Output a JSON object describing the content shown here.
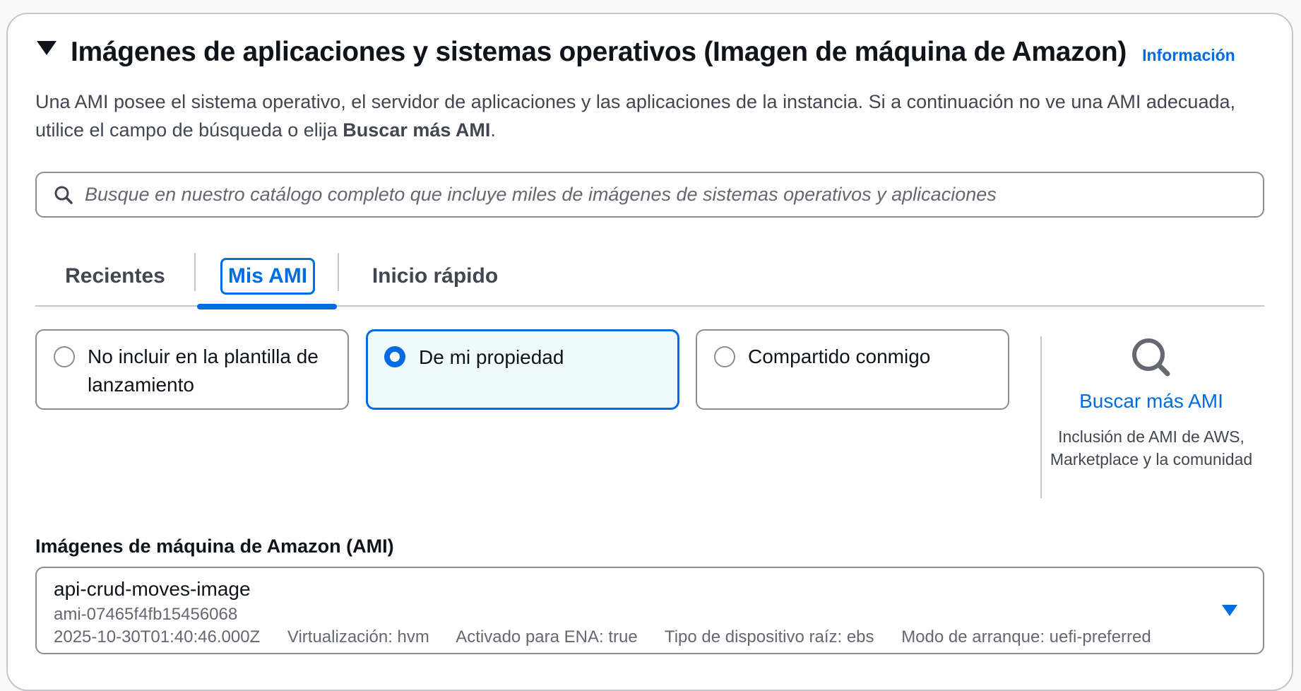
{
  "section": {
    "title": "Imágenes de aplicaciones y sistemas operativos (Imagen de máquina de Amazon)",
    "info_link": "Información",
    "description_prefix": "Una AMI posee el sistema operativo, el servidor de aplicaciones y las aplicaciones de la instancia. Si a continuación no ve una AMI adecuada, utilice el campo de búsqueda o elija ",
    "description_bold": "Buscar más AMI",
    "description_suffix": "."
  },
  "search": {
    "placeholder": "Busque en nuestro catálogo completo que incluye miles de imágenes de sistemas operativos y aplicaciones",
    "value": ""
  },
  "tabs": [
    {
      "label": "Recientes",
      "active": false
    },
    {
      "label": "Mis AMI",
      "active": true
    },
    {
      "label": "Inicio rápido",
      "active": false
    }
  ],
  "ownership_options": [
    {
      "label": "No incluir en la plantilla de lanzamiento",
      "selected": false
    },
    {
      "label": "De mi propiedad",
      "selected": true
    },
    {
      "label": "Compartido conmigo",
      "selected": false
    }
  ],
  "browse": {
    "icon": "search-icon",
    "link": "Buscar más AMI",
    "description": "Inclusión de AMI de AWS, Marketplace y la comunidad"
  },
  "ami_select": {
    "label": "Imágenes de máquina de Amazon (AMI)",
    "name": "api-crud-moves-image",
    "id": "ami-07465f4fb15456068",
    "created": "2025-10-30T01:40:46.000Z",
    "virtualization": "Virtualización: hvm",
    "ena": "Activado para ENA: true",
    "root_device": "Tipo de dispositivo raíz: ebs",
    "boot_mode": "Modo de arranque: uefi-preferred"
  },
  "colors": {
    "accent": "#006ce0",
    "selected_bg": "#f0fbff",
    "border": "#8c8c94",
    "text": "#0f141a",
    "secondary_text": "#424650"
  }
}
